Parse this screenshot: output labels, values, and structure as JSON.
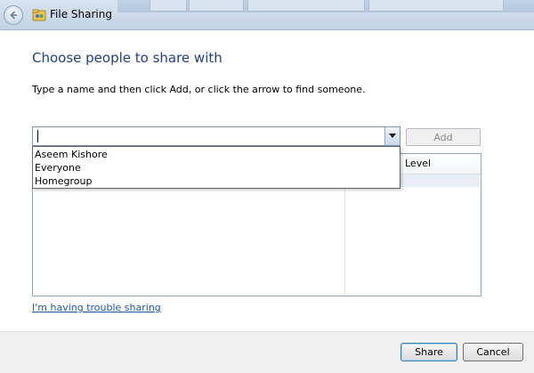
{
  "window": {
    "title": "File Sharing"
  },
  "content": {
    "heading": "Choose people to share with",
    "instruction": "Type a name and then click Add, or click the arrow to find someone.",
    "name_input": {
      "value": "",
      "placeholder": ""
    },
    "add_label": "Add",
    "list": {
      "level_header": "Level"
    },
    "dropdown_options": [
      "Aseem Kishore",
      "Everyone",
      "Homegroup"
    ],
    "trouble_link": "I'm having trouble sharing"
  },
  "footer": {
    "share_label": "Share",
    "cancel_label": "Cancel"
  },
  "colors": {
    "heading": "#1f3f8e",
    "link": "#1a5aa8",
    "footer_bg": "#f0f0f0",
    "titlebar": "#c2d3e6"
  },
  "icons": {
    "back": "back-arrow-icon",
    "app": "file-sharing-icon",
    "dropdown": "chevron-down-icon"
  }
}
